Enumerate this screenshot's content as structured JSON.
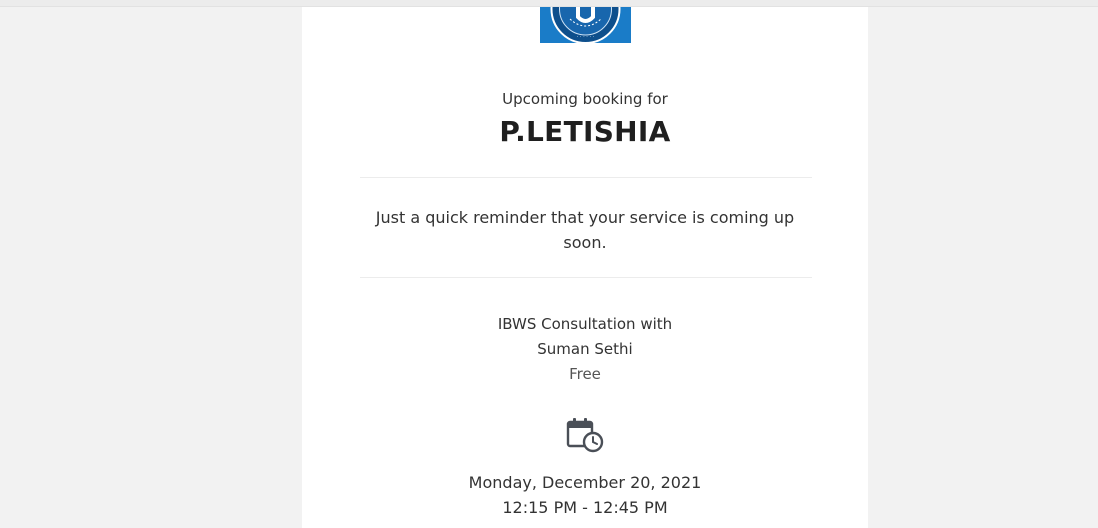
{
  "booking": {
    "greeting": "Upcoming booking for",
    "customer_name": "P.LETISHIA",
    "reminder": "Just a quick reminder that your service is coming up soon.",
    "service_line1": "IBWS Consultation with",
    "service_line2": "Suman Sethi",
    "price": "Free",
    "date": "Monday, December 20, 2021",
    "time": "12:15 PM - 12:45 PM"
  },
  "icons": {
    "logo": "brand-logo-icon",
    "calendar": "calendar-clock-icon"
  },
  "colors": {
    "page_background": "#f2f2f2",
    "card_background": "#ffffff",
    "logo_blue": "#1a7cc8",
    "icon_gray": "#4a4f57",
    "text": "#333333"
  }
}
